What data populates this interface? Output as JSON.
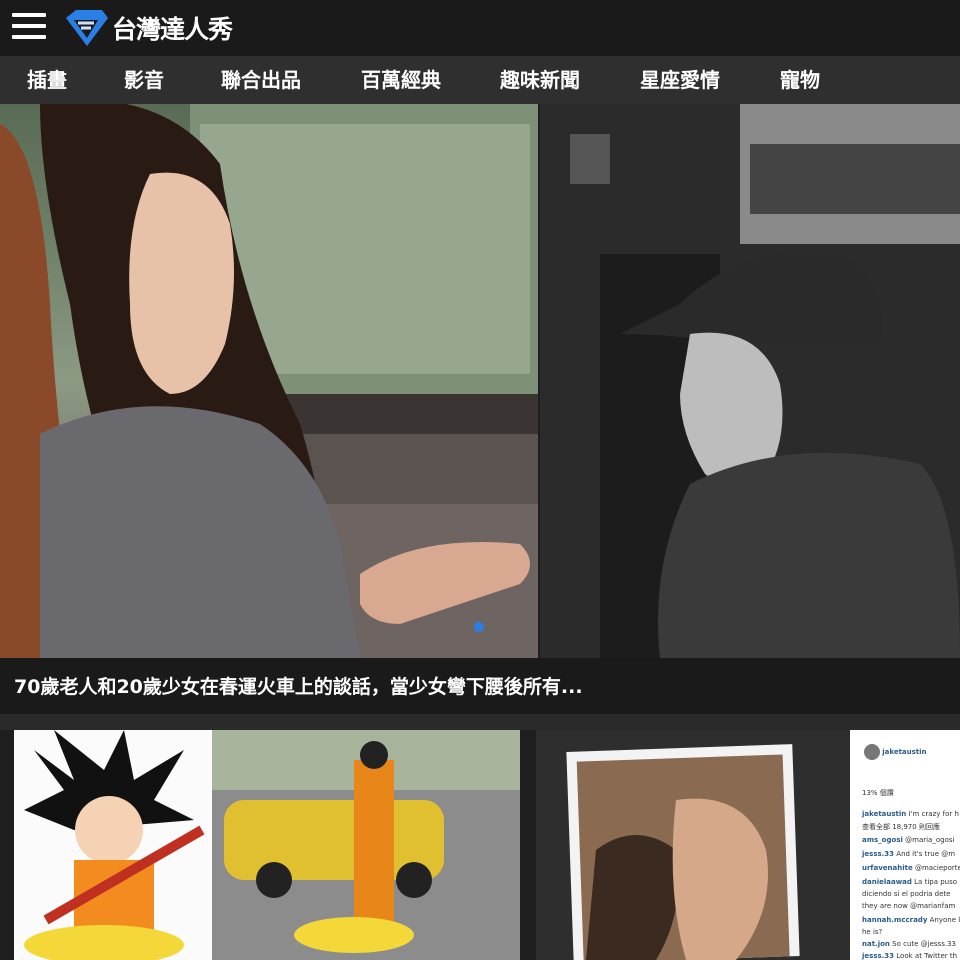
{
  "header": {
    "logo_text": "台灣達人秀",
    "brand_color": "#2a7fe6"
  },
  "nav": {
    "items": [
      {
        "label": "插畫"
      },
      {
        "label": "影音"
      },
      {
        "label": "聯合出品"
      },
      {
        "label": "百萬經典"
      },
      {
        "label": "趣味新聞"
      },
      {
        "label": "星座愛情"
      },
      {
        "label": "寵物"
      }
    ]
  },
  "hero": {
    "caption": "70歲老人和20歲少女在春運火車上的談話，當少女彎下腰後所有...",
    "active_slide_color": "#2a7fe6"
  },
  "thumbnails": {
    "instagram_panel": {
      "header_user": "jaketaustin",
      "likes": "13% 個讚",
      "comments": [
        {
          "user": "jaketaustin",
          "text": "I'm crazy for h"
        },
        {
          "user": "",
          "text": "查看全部 18,970 則回應"
        },
        {
          "user": "ams_ogosi",
          "text": "@maria_ogosi"
        },
        {
          "user": "jesss.33",
          "text": "And it's true @m"
        },
        {
          "user": "urfavenahite",
          "text": "@macieporte"
        },
        {
          "user": "danielaawad",
          "text": "La tipa puso"
        },
        {
          "user": "",
          "text": "diciendo si el podria dete"
        },
        {
          "user": "",
          "text": "they are now @marianfam"
        },
        {
          "user": "hannah.mccrady",
          "text": "Anyone l"
        },
        {
          "user": "",
          "text": "he is?"
        },
        {
          "user": "nat.jon",
          "text": "So cute @jesss.33"
        },
        {
          "user": "jesss.33",
          "text": "Look at Twitter th"
        }
      ]
    }
  }
}
